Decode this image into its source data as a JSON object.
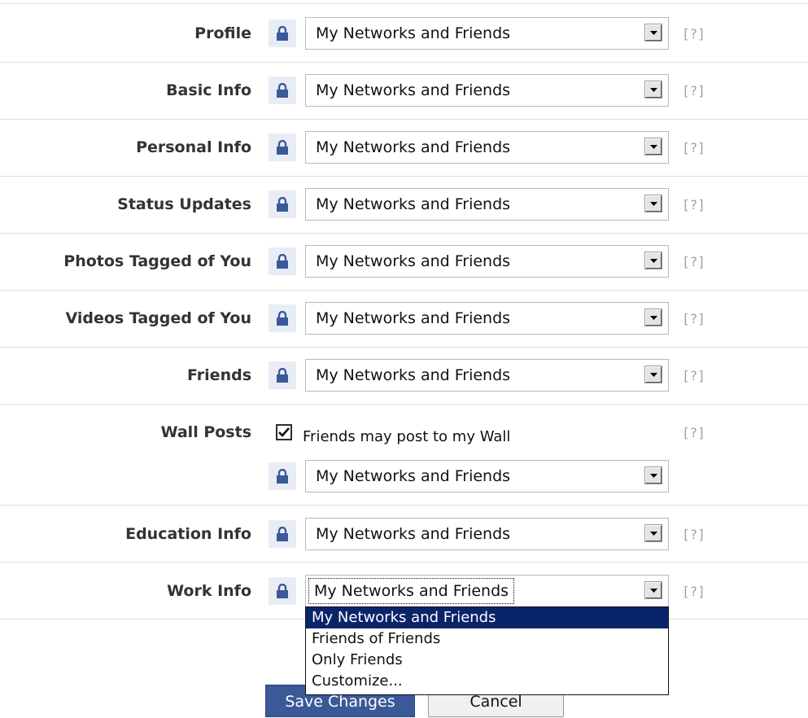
{
  "rows": [
    {
      "label": "Profile",
      "value": "My Networks and Friends",
      "help": "[?]"
    },
    {
      "label": "Basic Info",
      "value": "My Networks and Friends",
      "help": "[?]"
    },
    {
      "label": "Personal Info",
      "value": "My Networks and Friends",
      "help": "[?]"
    },
    {
      "label": "Status Updates",
      "value": "My Networks and Friends",
      "help": "[?]"
    },
    {
      "label": "Photos Tagged of You",
      "value": "My Networks and Friends",
      "help": "[?]"
    },
    {
      "label": "Videos Tagged of You",
      "value": "My Networks and Friends",
      "help": "[?]"
    },
    {
      "label": "Friends",
      "value": "My Networks and Friends",
      "help": "[?]"
    }
  ],
  "wall_posts": {
    "label": "Wall Posts",
    "checkbox_label": "Friends may post to my Wall",
    "checked": true,
    "help": "[?]",
    "value": "My Networks and Friends"
  },
  "education": {
    "label": "Education Info",
    "value": "My Networks and Friends",
    "help": "[?]"
  },
  "work": {
    "label": "Work Info",
    "value": "My Networks and Friends",
    "help": "[?]"
  },
  "dropdown_options": [
    "My Networks and Friends",
    "Friends of Friends",
    "Only Friends",
    "Customize..."
  ],
  "selected_option": "My Networks and Friends",
  "buttons": {
    "save": "Save Changes",
    "cancel": "Cancel"
  },
  "colors": {
    "brand": "#3b5998",
    "highlight": "#0a246a",
    "separator": "#d8dfea"
  }
}
